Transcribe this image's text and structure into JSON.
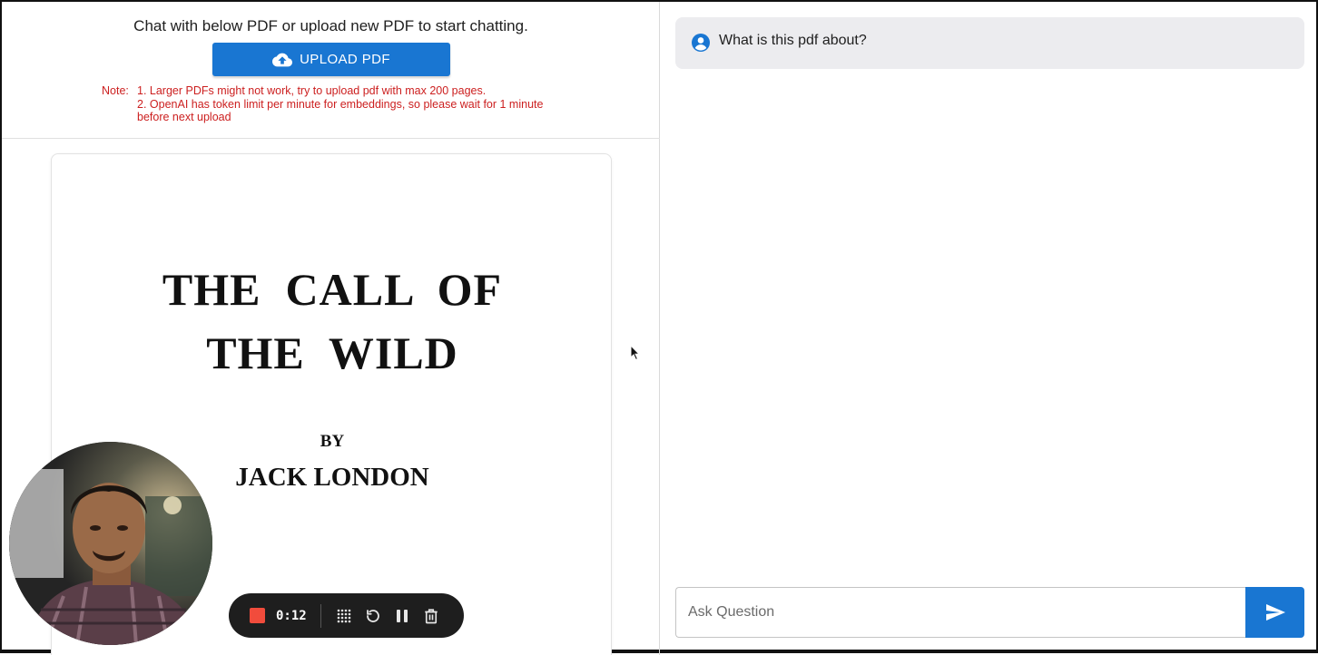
{
  "upload": {
    "intro": "Chat with below PDF or upload new PDF to start chatting.",
    "button_label": "UPLOAD PDF",
    "note_label": "Note:",
    "note_lines": [
      "1. Larger PDFs might not work, try to upload pdf with max 200 pages.",
      "2. OpenAI has token limit per minute for embeddings, so please wait for 1 minute before next upload"
    ]
  },
  "pdf": {
    "title_line1": "THE  CALL  OF",
    "title_line2": "THE  WILD",
    "by": "BY",
    "author": "JACK LONDON"
  },
  "recorder": {
    "time": "0:12",
    "icons": [
      "stop-icon",
      "grid-icon",
      "restart-icon",
      "pause-icon",
      "trash-icon"
    ]
  },
  "chat": {
    "question": "What is this pdf about?",
    "input_placeholder": "Ask Question"
  },
  "colors": {
    "primary": "#1976d2",
    "note_red": "#cc1f1f",
    "bubble_bg": "#ececef",
    "recorder_bg": "#1e1e1e",
    "record_red": "#f14c3c"
  }
}
